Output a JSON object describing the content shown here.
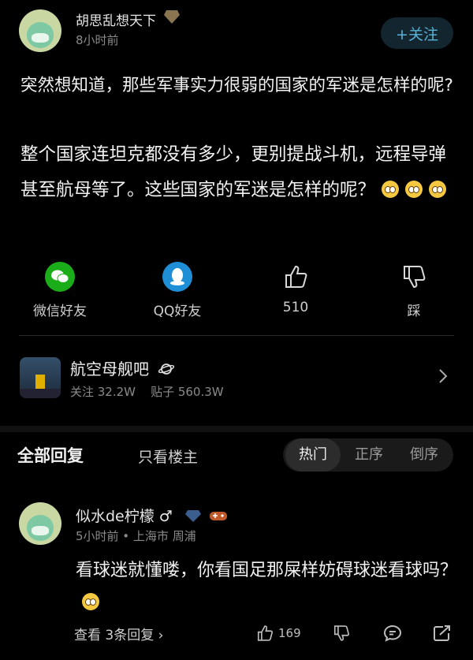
{
  "post": {
    "author": "胡思乱想天下",
    "time": "8小时前",
    "follow_label": "+关注",
    "title": "突然想知道，那些军事实力很弱的国家的军迷是怎样的呢?",
    "body": "整个国家连坦克都没有多少，更别提战斗机，远程导弹甚至航母等了。这些国家的军迷是怎样的呢？"
  },
  "actions": {
    "wechat": "微信好友",
    "qq": "QQ好友",
    "like_count": "510",
    "dislike": "踩"
  },
  "forum": {
    "name": "航空母舰吧",
    "stats": "关注 32.2W    贴子 560.3W"
  },
  "replies_header": {
    "all": "全部回复",
    "op_only": "只看楼主",
    "sort": [
      "热门",
      "正序",
      "倒序"
    ]
  },
  "reply": {
    "name": "似水de柠檬 ♂",
    "meta": "5小时前 • 上海市 周浦",
    "text": "看球迷就懂喽，你看国足那屎样妨碍球迷看球吗？",
    "view_replies": "查看 3条回复 ›",
    "like_count": "169"
  }
}
